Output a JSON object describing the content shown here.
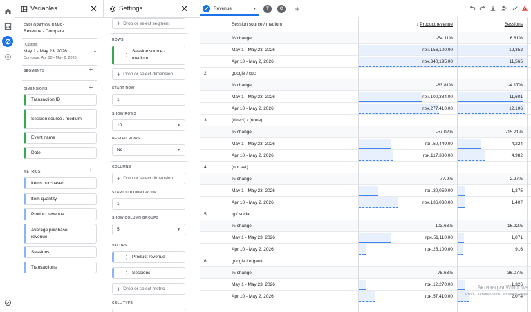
{
  "variables": {
    "title": "Variables",
    "exploration_name_label": "EXPLORATION NAME:",
    "exploration_name": "Revenue - Compare",
    "date_custom_label": "Custom",
    "date_range": "May 1 - May 23, 2026",
    "compare_range": "Compare: Apr 10 - May 2, 2026",
    "segments_label": "SEGMENTS",
    "dimensions_label": "DIMENSIONS",
    "dimensions": [
      "Transaction ID",
      "Session source / medium",
      "Event name",
      "Date"
    ],
    "metrics_label": "METRICS",
    "metrics": [
      "Items purchased",
      "Item quantity",
      "Product revenue",
      "Average purchase revenue",
      "Sessions",
      "Transactions"
    ]
  },
  "settings": {
    "title": "Settings",
    "segment_drop": "Drop or select segment",
    "rows_label": "ROWS",
    "rows_chip": "Session source / medium",
    "rows_drop": "Drop or select dimension",
    "start_row_label": "START ROW",
    "start_row": "1",
    "show_rows_label": "SHOW ROWS",
    "show_rows": "10",
    "nested_rows_label": "NESTED ROWS",
    "nested_rows": "No",
    "columns_label": "COLUMNS",
    "columns_drop": "Drop or select dimension",
    "start_col_group_label": "START COLUMN GROUP",
    "start_col_group": "1",
    "show_col_groups_label": "SHOW COLUMN GROUPS",
    "show_col_groups": "5",
    "values_label": "VALUES",
    "values": [
      "Product revenue",
      "Sessions"
    ],
    "metric_drop": "Drop or select metric",
    "cell_type_label": "CELL TYPE"
  },
  "tabs": {
    "active": "Revenue",
    "others": [
      "T",
      "C"
    ]
  },
  "table": {
    "col_dim": "Session source / medium",
    "col_rev": "Product revenue",
    "col_ses": "Sessions",
    "rows": [
      {
        "kind": "pct",
        "num": "",
        "label": "% change",
        "rev": "-54.11%",
        "ses": "6.81%"
      },
      {
        "kind": "cur",
        "num": "",
        "label": "May 1 - May 23, 2026",
        "rev": "грн.156,100.00",
        "ses": "12,352",
        "rev_frac": 1.0,
        "ses_frac": 1.0
      },
      {
        "kind": "cmp",
        "num": "",
        "label": "Apr 10 - May 2, 2026",
        "rev": "грн.340,195.00",
        "ses": "11,565",
        "rev_frac": 1.0,
        "ses_frac": 1.0
      },
      {
        "kind": "dim",
        "num": "2",
        "label": "google / cpc",
        "rev": "",
        "ses": ""
      },
      {
        "kind": "pct",
        "num": "",
        "label": "% change",
        "rev": "-63.81%",
        "ses": "-4.17%"
      },
      {
        "kind": "cur",
        "num": "",
        "label": "May 1 - May 23, 2026",
        "rev": "грн.100,384.00",
        "ses": "11,601",
        "rev_frac": 0.643,
        "ses_frac": 0.939
      },
      {
        "kind": "cmp",
        "num": "",
        "label": "Apr 10 - May 2, 2026",
        "rev": "грн.277,410.00",
        "ses": "12,106",
        "rev_frac": 0.815,
        "ses_frac": 0.98
      },
      {
        "kind": "dim",
        "num": "3",
        "label": "(direct) / (none)",
        "rev": "",
        "ses": ""
      },
      {
        "kind": "pct",
        "num": "",
        "label": "% change",
        "rev": "-57.02%",
        "ses": "-15.21%"
      },
      {
        "kind": "cur",
        "num": "",
        "label": "May 1 - May 23, 2026",
        "rev": "грн.50,449.00",
        "ses": "4,224",
        "rev_frac": 0.323,
        "ses_frac": 0.342
      },
      {
        "kind": "cmp",
        "num": "",
        "label": "Apr 10 - May 2, 2026",
        "rev": "грн.117,380.00",
        "ses": "4,982",
        "rev_frac": 0.345,
        "ses_frac": 0.403
      },
      {
        "kind": "dim",
        "num": "4",
        "label": "(not set)",
        "rev": "",
        "ses": ""
      },
      {
        "kind": "pct",
        "num": "",
        "label": "% change",
        "rev": "-77.9%",
        "ses": "-2.27%"
      },
      {
        "kind": "cur",
        "num": "",
        "label": "May 1 - May 23, 2026",
        "rev": "грн.30,059.00",
        "ses": "1,375",
        "rev_frac": 0.193,
        "ses_frac": 0.111
      },
      {
        "kind": "cmp",
        "num": "",
        "label": "Apr 10 - May 2, 2026",
        "rev": "грн.136,030.00",
        "ses": "1,407",
        "rev_frac": 0.4,
        "ses_frac": 0.114
      },
      {
        "kind": "dim",
        "num": "5",
        "label": "ig / social",
        "rev": "",
        "ses": ""
      },
      {
        "kind": "pct",
        "num": "",
        "label": "% change",
        "rev": "103.63%",
        "ses": "16.92%"
      },
      {
        "kind": "cur",
        "num": "",
        "label": "May 1 - May 23, 2026",
        "rev": "грн.51,110.00",
        "ses": "1,071",
        "rev_frac": 0.327,
        "ses_frac": 0.087
      },
      {
        "kind": "cmp",
        "num": "",
        "label": "Apr 10 - May 2, 2026",
        "rev": "грн.25,100.00",
        "ses": "916",
        "rev_frac": 0.074,
        "ses_frac": 0.074
      },
      {
        "kind": "dim",
        "num": "6",
        "label": "google / organic",
        "rev": "",
        "ses": ""
      },
      {
        "kind": "pct",
        "num": "",
        "label": "% change",
        "rev": "-78.63%",
        "ses": "-36.07%"
      },
      {
        "kind": "cur",
        "num": "",
        "label": "May 1 - May 23, 2026",
        "rev": "грн.12,270.00",
        "ses": "1,326",
        "rev_frac": 0.079,
        "ses_frac": 0.107
      },
      {
        "kind": "cmp",
        "num": "",
        "label": "Apr 10 - May 2, 2026",
        "rev": "грн.57,410.00",
        "ses": "2,074",
        "rev_frac": 0.169,
        "ses_frac": 0.168
      }
    ]
  },
  "watermark": {
    "line1": "Активация Windows",
    "line2": "Чтобы активировать Windows, пере"
  },
  "colors": {
    "accent": "#1a73e8",
    "bar": "#e8f0fe",
    "bar_line": "#4285f4",
    "dim_chip": "#34a853",
    "metric_chip": "#8ab4f8",
    "warning": "#ea4335"
  }
}
